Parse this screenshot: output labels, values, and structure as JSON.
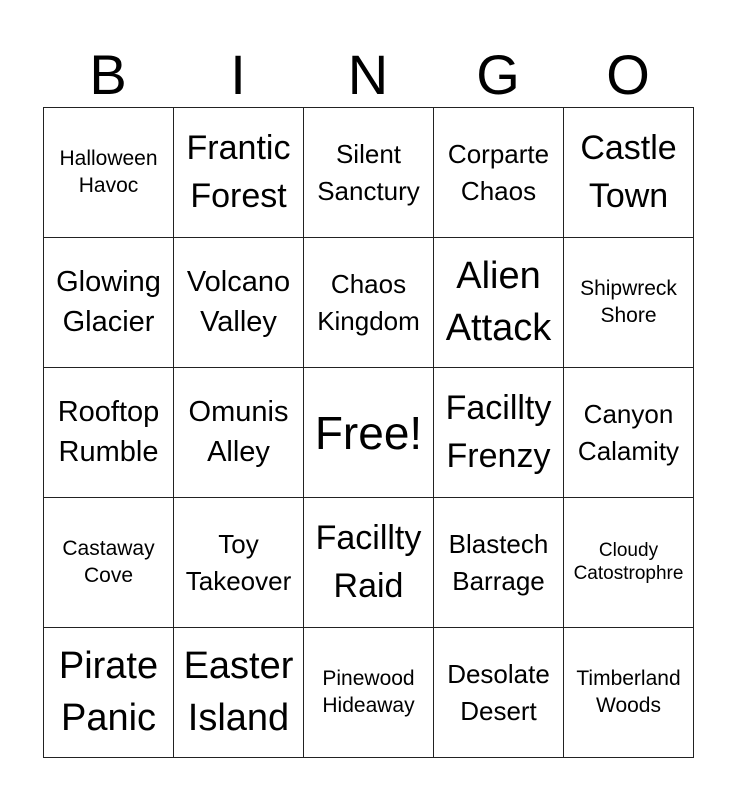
{
  "title_letters": [
    "B",
    "I",
    "N",
    "G",
    "O"
  ],
  "rows": [
    [
      {
        "lines": [
          "Halloween",
          "Havoc"
        ],
        "size": "s"
      },
      {
        "lines": [
          "Frantic",
          "Forest"
        ],
        "size": "xl"
      },
      {
        "lines": [
          "Silent",
          "Sanctury"
        ],
        "size": "m"
      },
      {
        "lines": [
          "Corparte",
          "Chaos"
        ],
        "size": "m"
      },
      {
        "lines": [
          "Castle",
          "Town"
        ],
        "size": "xl"
      }
    ],
    [
      {
        "lines": [
          "Glowing",
          "Glacier"
        ],
        "size": "l"
      },
      {
        "lines": [
          "Volcano",
          "Valley"
        ],
        "size": "l"
      },
      {
        "lines": [
          "Chaos",
          "Kingdom"
        ],
        "size": "m"
      },
      {
        "lines": [
          "Alien",
          "Attack"
        ],
        "size": "xxl"
      },
      {
        "lines": [
          "Shipwreck",
          "Shore"
        ],
        "size": "s"
      }
    ],
    [
      {
        "lines": [
          "Rooftop",
          "Rumble"
        ],
        "size": "l"
      },
      {
        "lines": [
          "Omunis",
          "Alley"
        ],
        "size": "l"
      },
      {
        "lines": [
          "Free!"
        ],
        "size": "free"
      },
      {
        "lines": [
          "Facillty",
          "Frenzy"
        ],
        "size": "xl"
      },
      {
        "lines": [
          "Canyon",
          "Calamity"
        ],
        "size": "m"
      }
    ],
    [
      {
        "lines": [
          "Castaway",
          "Cove"
        ],
        "size": "s"
      },
      {
        "lines": [
          "Toy",
          "Takeover"
        ],
        "size": "m"
      },
      {
        "lines": [
          "Facillty",
          "Raid"
        ],
        "size": "xl"
      },
      {
        "lines": [
          "Blastech",
          "Barrage"
        ],
        "size": "m"
      },
      {
        "lines": [
          "Cloudy",
          "Catostrophre"
        ],
        "size": "xs"
      }
    ],
    [
      {
        "lines": [
          "Pirate",
          "Panic"
        ],
        "size": "xxl"
      },
      {
        "lines": [
          "Easter",
          "Island"
        ],
        "size": "xxl"
      },
      {
        "lines": [
          "Pinewood",
          "Hideaway"
        ],
        "size": "s"
      },
      {
        "lines": [
          "Desolate",
          "Desert"
        ],
        "size": "m"
      },
      {
        "lines": [
          "Timberland",
          "Woods"
        ],
        "size": "s"
      }
    ]
  ]
}
